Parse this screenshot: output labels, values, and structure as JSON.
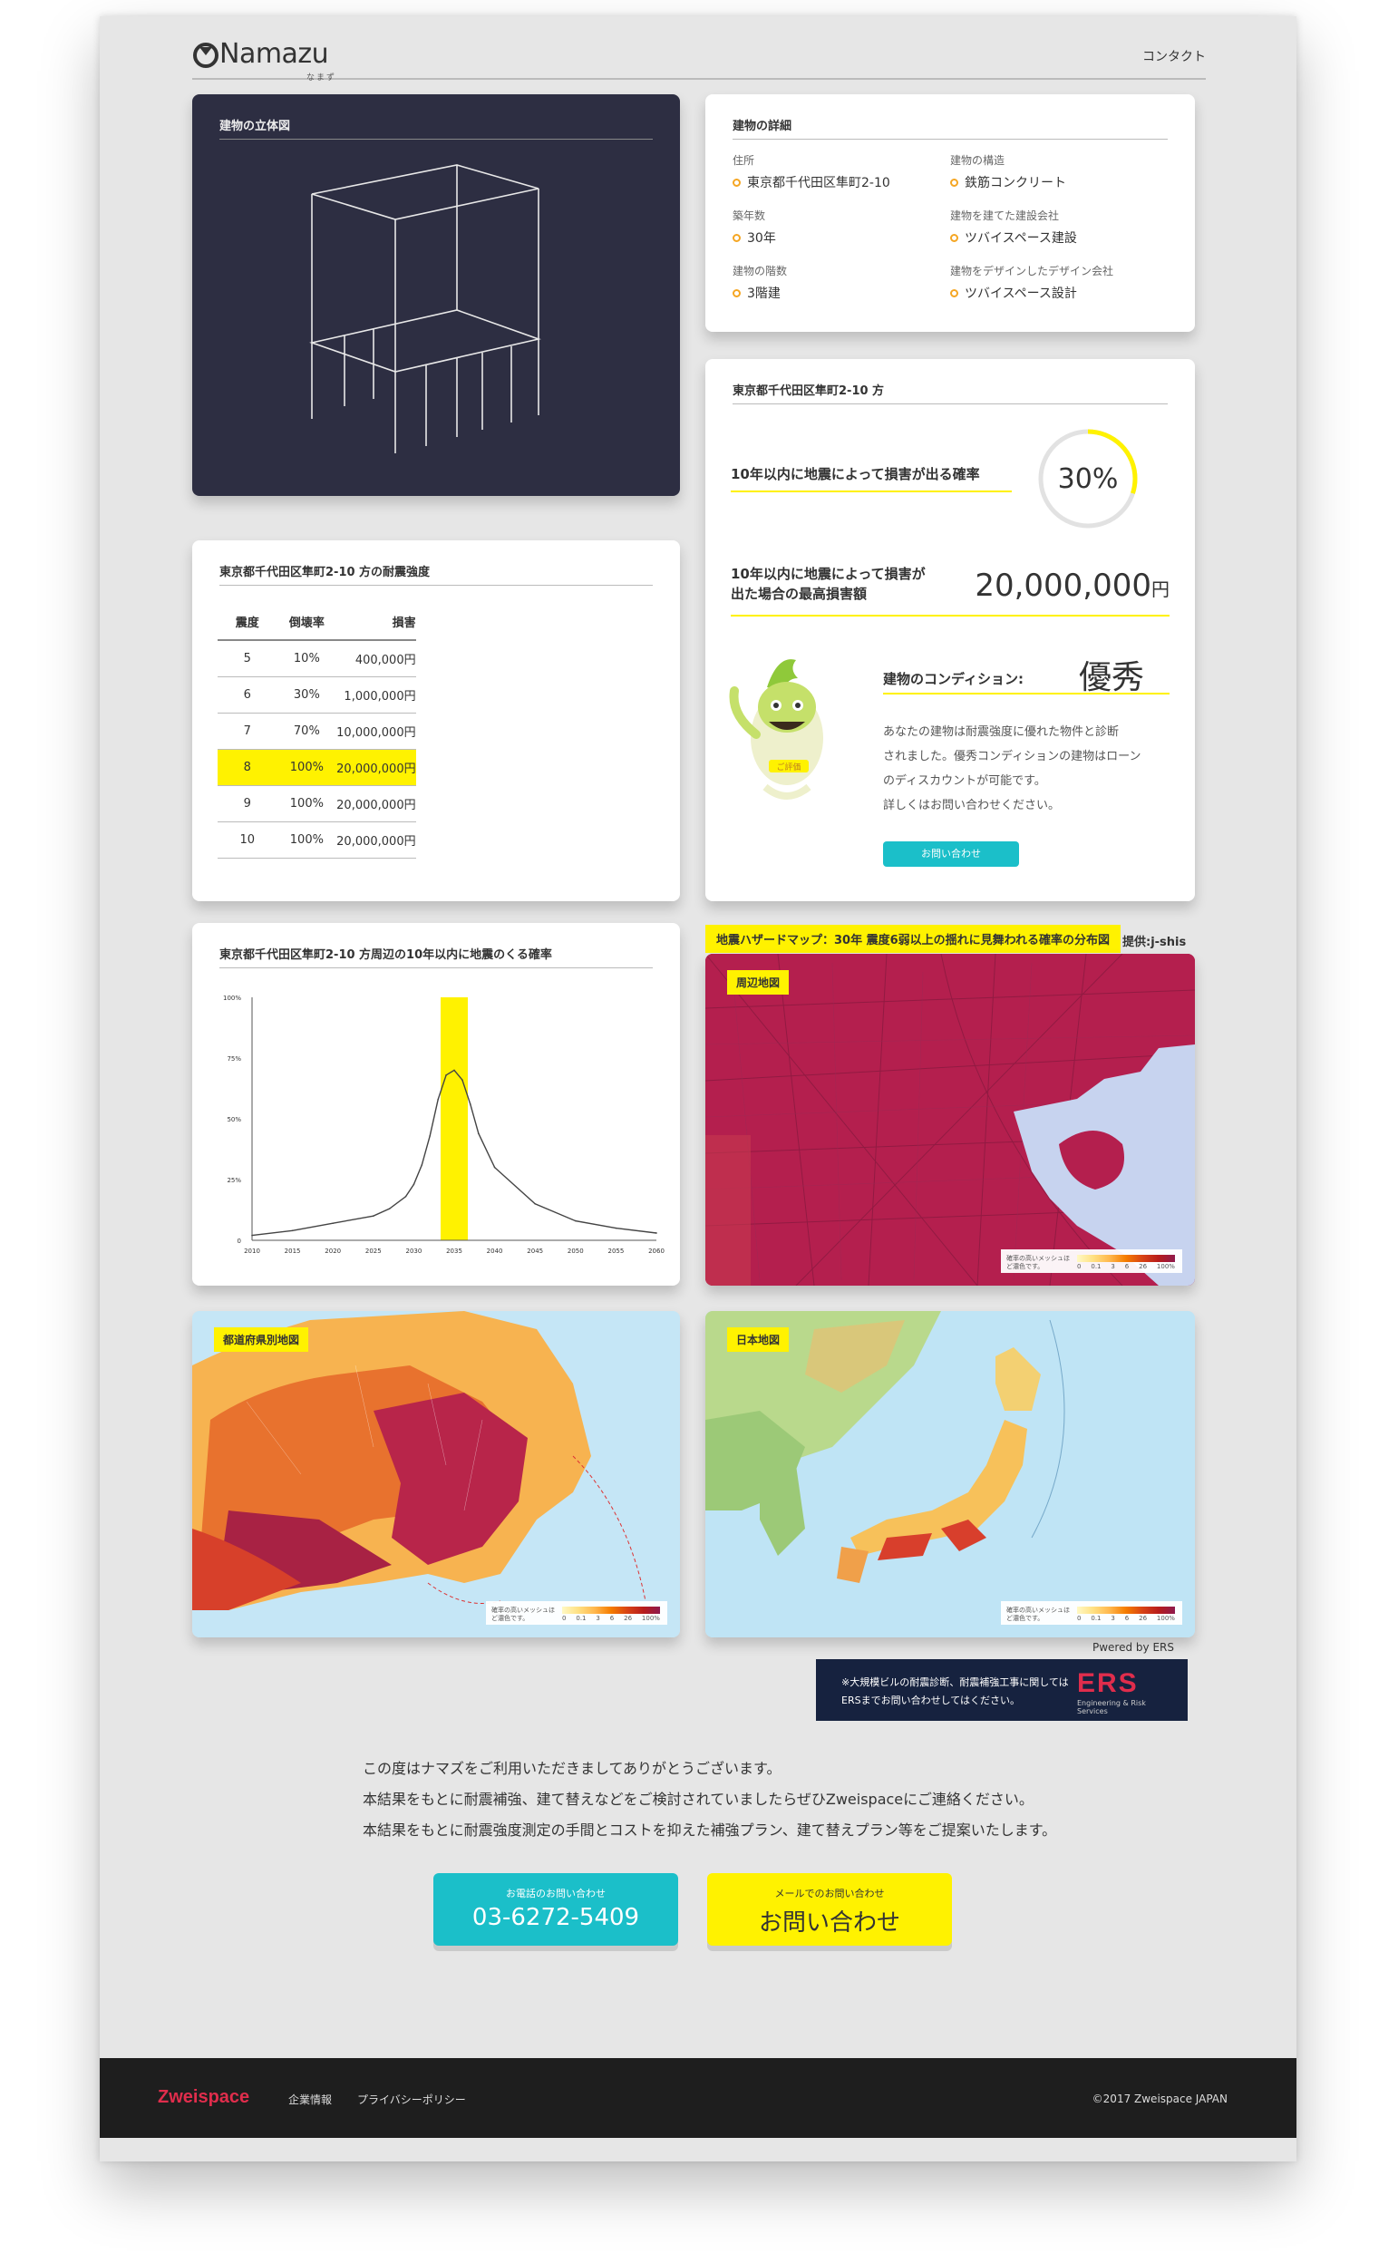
{
  "header": {
    "logo_text": "Namazu",
    "logo_sub": "なまず",
    "contact": "コンタクト"
  },
  "model_card": {
    "title": "建物の立体図"
  },
  "details": {
    "title": "建物の詳細",
    "items": [
      {
        "label": "住所",
        "value": "東京都千代田区隼町2-10"
      },
      {
        "label": "建物の構造",
        "value": "鉄筋コンクリート"
      },
      {
        "label": "築年数",
        "value": "30年"
      },
      {
        "label": "建物を建てた建設会社",
        "value": "ツバイスペース建設"
      },
      {
        "label": "建物の階数",
        "value": "3階建"
      },
      {
        "label": "建物をデザインしたデザイン会社",
        "value": "ツバイスペース設計"
      }
    ]
  },
  "risk": {
    "title": "東京都千代田区隼町2-10 方",
    "prob_label": "10年以内に地震によって損害が出る確率",
    "prob_value": "30%",
    "prob_fraction": 0.3,
    "loss_label_1": "10年以内に地震によって損害が",
    "loss_label_2": "出た場合の最高損害額",
    "loss_value": "20,000,000",
    "loss_unit": "円",
    "condition_label": "建物のコンディション:",
    "condition_value": "優秀",
    "mascot_badge": "ご評価",
    "desc": [
      "あなたの建物は耐震強度に優れた物件と診断",
      "されました。優秀コンディションの建物はローン",
      "のディスカウントが可能です。",
      "詳しくはお問い合わせください。"
    ],
    "inquiry_button": "お問い合わせ"
  },
  "strength": {
    "title": "東京都千代田区隼町2-10 方の耐震強度",
    "headers": [
      "震度",
      "倒壊率",
      "損害"
    ],
    "rows": [
      {
        "intensity": "5",
        "rate": "10%",
        "damage": "400,000円",
        "highlight": false
      },
      {
        "intensity": "6",
        "rate": "30%",
        "damage": "1,000,000円",
        "highlight": false
      },
      {
        "intensity": "7",
        "rate": "70%",
        "damage": "10,000,000円",
        "highlight": false
      },
      {
        "intensity": "8",
        "rate": "100%",
        "damage": "20,000,000円",
        "highlight": true
      },
      {
        "intensity": "9",
        "rate": "100%",
        "damage": "20,000,000円",
        "highlight": false
      },
      {
        "intensity": "10",
        "rate": "100%",
        "damage": "20,000,000円",
        "highlight": false
      }
    ]
  },
  "prob_chart": {
    "title": "東京都千代田区隼町2-10 方周辺の10年以内に地震のくる確率"
  },
  "chart_data": {
    "type": "line",
    "title": "東京都千代田区隼町2-10 方周辺の10年以内に地震のくる確率",
    "x": [
      2010,
      2015,
      2020,
      2025,
      2027,
      2029,
      2030,
      2031,
      2032,
      2033,
      2034,
      2035,
      2036,
      2037,
      2038,
      2040,
      2045,
      2050,
      2055,
      2060
    ],
    "values": [
      2,
      4,
      7,
      10,
      13,
      18,
      23,
      31,
      43,
      58,
      68,
      70,
      66,
      56,
      44,
      30,
      15,
      8,
      5,
      3
    ],
    "x_ticks": [
      "2010",
      "2015",
      "2020",
      "2025",
      "2030",
      "2035",
      "2040",
      "2045",
      "2050",
      "2055",
      "2060"
    ],
    "y_ticks": [
      "0",
      "25%",
      "50%",
      "75%",
      "100%"
    ],
    "xlim": [
      2010,
      2060
    ],
    "ylim": [
      0,
      100
    ],
    "highlight_x": 2035,
    "highlight_color": "#fff200",
    "grid": false
  },
  "hazard": {
    "title": "地震ハザードマップ：30年 震度6弱以上の揺れに見舞われる確率の分布図",
    "source": "提供:j-shis",
    "maps": [
      {
        "label": "周辺地図"
      },
      {
        "label": "都道府県別地図"
      },
      {
        "label": "日本地図"
      }
    ],
    "legend_note": "確率の高いメッシュほど濃色です。",
    "legend_ticks": [
      "0",
      "0.1",
      "3",
      "6",
      "26",
      "100%"
    ]
  },
  "ers": {
    "powered": "Pwered by ERS",
    "line1": "※大規模ビルの耐震診断、耐震補強工事に関しては",
    "line2": "ERSまでお問い合わせしてはください。",
    "logo": "ERS",
    "logo_sub": "Engineering & Risk Services"
  },
  "thanks": {
    "lines": [
      "この度はナマズをご利用いただきましてありがとうございます。",
      "本結果をもとに耐震補強、建て替えなどをご検討されていましたらぜひZweispaceにご連絡ください。",
      "本結果をもとに耐震強度測定の手間とコストを抑えた補強プラン、建て替えプラン等をご提案いたします。"
    ]
  },
  "cta": {
    "tel_sub": "お電話のお問い合わせ",
    "tel_main": "03-6272-5409",
    "mail_sub": "メールでのお問い合わせ",
    "mail_main": "お問い合わせ"
  },
  "footer": {
    "brand": "Zweispace",
    "links": [
      "企業情報",
      "プライバシーポリシー"
    ],
    "copyright": "©2017 Zweispace JAPAN"
  },
  "colors": {
    "accent_yellow": "#fff200",
    "accent_teal": "#1bbfc9",
    "brand_red": "#e02d4c",
    "dark_card": "#2d2e42"
  }
}
